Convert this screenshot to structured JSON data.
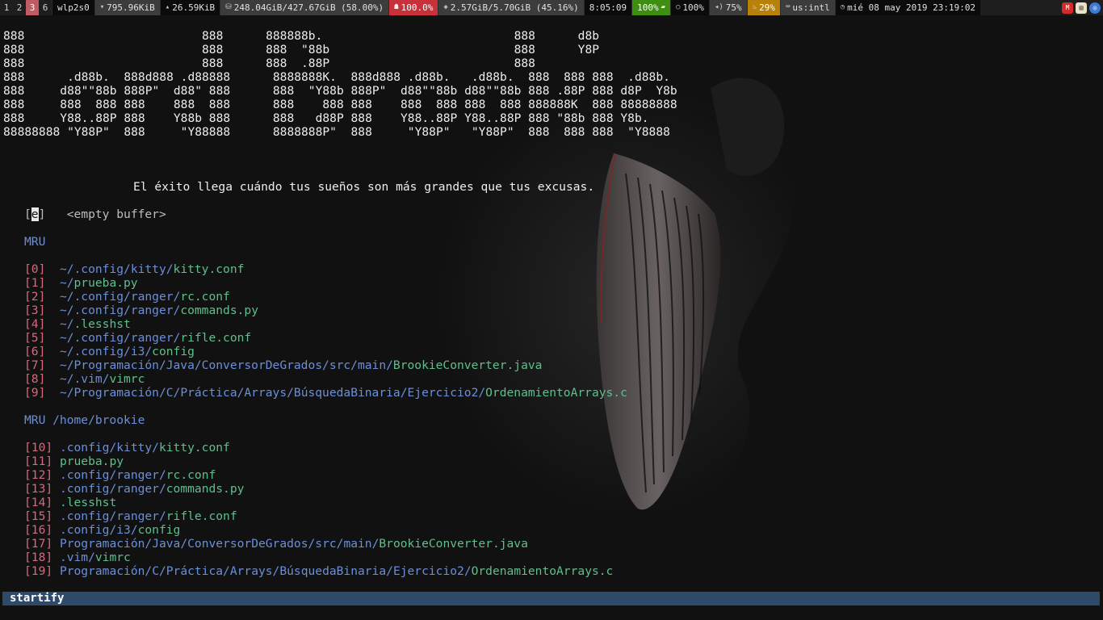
{
  "bar": {
    "workspaces": [
      {
        "label": "1",
        "focused": false
      },
      {
        "label": "2",
        "focused": false
      },
      {
        "label": "3",
        "focused": true
      },
      {
        "label": "6",
        "focused": false
      }
    ],
    "network": "wlp2s0",
    "download": "795.96KiB",
    "upload": "26.59KiB",
    "disk": "248.04GiB/427.67GiB (58.00%)",
    "cpu": "100.0%",
    "memory": "2.57GiB/5.70GiB (45.16%)",
    "uptime": "8:05:09",
    "battery": "100%",
    "brightness": "100%",
    "volume": "75%",
    "temperature": "29%",
    "keyboard": "us:intl",
    "datetime": "mié 08 may 2019 23:19:02",
    "colors": {
      "focused_ws": "#c05a64",
      "cpu": "#c8303a",
      "battery": "#3e8f10",
      "temp": "#b8820a"
    }
  },
  "terminal": {
    "banner": [
      "888                         888      888888b.                           888      d8b",
      "888                         888      888  \"88b                          888      Y8P",
      "888                         888      888  .88P                          888",
      "888      .d88b.  888d888 .d88888      8888888K.  888d888 .d88b.   .d88b.  888  888 888  .d88b.",
      "888     d88\"\"88b 888P\"  d88\" 888      888  \"Y88b 888P\"  d88\"\"88b d88\"\"88b 888 .88P 888 d8P  Y8b",
      "888     888  888 888    888  888      888    888 888    888  888 888  888 888888K  888 88888888",
      "888     Y88..88P 888    Y88b 888      888   d88P 888    Y88..88P Y88..88P 888 \"88b 888 Y8b.",
      "88888888 \"Y88P\"  888     \"Y88888      8888888P\"  888     \"Y88P\"   \"Y88P\"  888  888 888  \"Y8888"
    ],
    "quote": "El éxito llega cuándo tus sueños son más grandes que tus excusas.",
    "empty_buffer": {
      "key": "e",
      "label": "<empty buffer>"
    },
    "mru_heading": "MRU",
    "mru": [
      {
        "index": "[0]",
        "dirs": [
          "~/.config/",
          "kitty/"
        ],
        "file": "kitty.conf"
      },
      {
        "index": "[1]",
        "dirs": [
          "~/"
        ],
        "file": "prueba.py"
      },
      {
        "index": "[2]",
        "dirs": [
          "~/.config/",
          "ranger/"
        ],
        "file": "rc.conf"
      },
      {
        "index": "[3]",
        "dirs": [
          "~/.config/",
          "ranger/"
        ],
        "file": "commands.py"
      },
      {
        "index": "[4]",
        "dirs": [
          "~/"
        ],
        "file": ".lesshst"
      },
      {
        "index": "[5]",
        "dirs": [
          "~/.config/",
          "ranger/"
        ],
        "file": "rifle.conf"
      },
      {
        "index": "[6]",
        "dirs": [
          "~/.config/",
          "i3/"
        ],
        "file": "config"
      },
      {
        "index": "[7]",
        "dirs": [
          "~/Programación/",
          "Java/",
          "ConversorDeGrados/",
          "src/",
          "main/"
        ],
        "file": "BrookieConverter.java"
      },
      {
        "index": "[8]",
        "dirs": [
          "~/.vim/"
        ],
        "file": "vimrc"
      },
      {
        "index": "[9]",
        "dirs": [
          "~/Programación/",
          "C/",
          "Práctica/",
          "Arrays/",
          "BúsquedaBinaria/",
          "Ejercicio2/"
        ],
        "file": "OrdenamientoArrays.c"
      }
    ],
    "mru_dir_heading": "MRU /home/brookie",
    "mru_dir": [
      {
        "index": "[10]",
        "dirs": [
          ".config/",
          "kitty/"
        ],
        "file": "kitty.conf"
      },
      {
        "index": "[11]",
        "dirs": [],
        "file": "prueba.py"
      },
      {
        "index": "[12]",
        "dirs": [
          ".config/",
          "ranger/"
        ],
        "file": "rc.conf"
      },
      {
        "index": "[13]",
        "dirs": [
          ".config/",
          "ranger/"
        ],
        "file": "commands.py"
      },
      {
        "index": "[14]",
        "dirs": [],
        "file": ".lesshst"
      },
      {
        "index": "[15]",
        "dirs": [
          ".config/",
          "ranger/"
        ],
        "file": "rifle.conf"
      },
      {
        "index": "[16]",
        "dirs": [
          ".config/",
          "i3/"
        ],
        "file": "config"
      },
      {
        "index": "[17]",
        "dirs": [
          "Programación/",
          "Java/",
          "ConversorDeGrados/",
          "src/",
          "main/"
        ],
        "file": "BrookieConverter.java"
      },
      {
        "index": "[18]",
        "dirs": [
          ".vim/"
        ],
        "file": "vimrc"
      },
      {
        "index": "[19]",
        "dirs": [
          "Programación/",
          "C/",
          "Práctica/",
          "Arrays/",
          "BúsquedaBinaria/",
          "Ejercicio2/"
        ],
        "file": "OrdenamientoArrays.c"
      }
    ]
  },
  "statusline": {
    "label": "startify"
  }
}
